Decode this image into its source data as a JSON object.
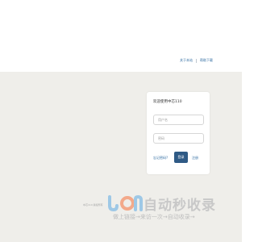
{
  "header": {
    "links": [
      {
        "label": "关于本站"
      },
      {
        "label": "帮助下载"
      }
    ]
  },
  "login": {
    "title": "欢迎使用中芯110",
    "username_placeholder": "用户名",
    "password_placeholder": "密码",
    "forgot_label": "忘记密码?",
    "login_label": "登录",
    "register_label": "注册"
  },
  "footer": {
    "text": "中芯110 版权所有"
  },
  "watermark": {
    "title": "自动秒收录",
    "subtitle": "做上链接→来访一次→自动收录→"
  },
  "colors": {
    "accent": "#2f5a85",
    "link": "#2c6aa0",
    "background": "#efeeea"
  }
}
